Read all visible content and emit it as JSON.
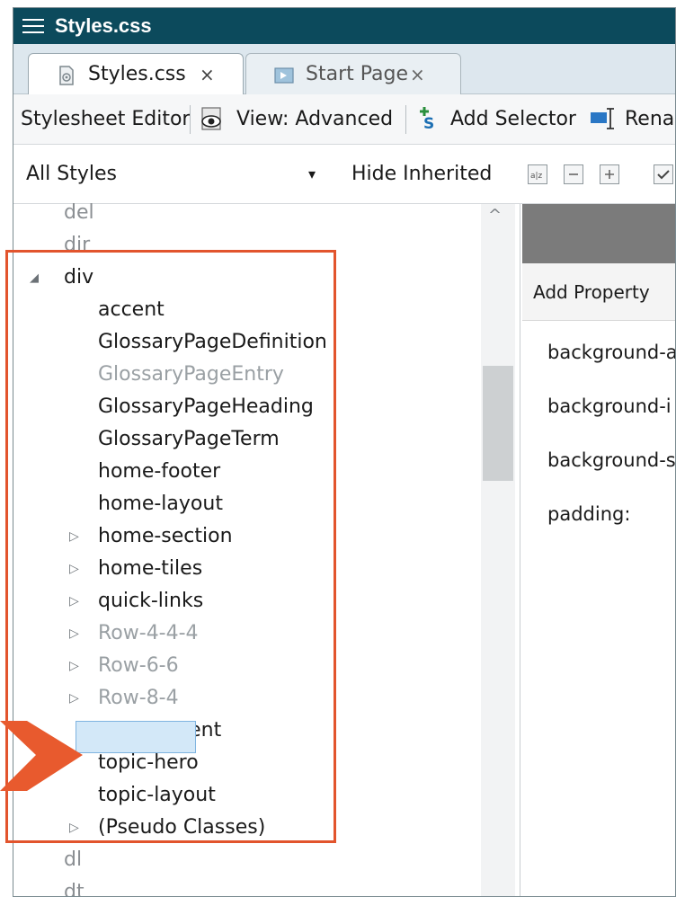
{
  "window": {
    "title": "Styles.css"
  },
  "tabs": [
    {
      "label": "Styles.css",
      "close": "×",
      "active": true
    },
    {
      "label": "Start Page",
      "close": "×",
      "active": false
    }
  ],
  "toolbar": {
    "editor_label": "Stylesheet Editor",
    "view_label": "View: Advanced",
    "add_selector_label": "Add Selector",
    "rename_label": "Rena"
  },
  "filterbar": {
    "dropdown_value": "All Styles",
    "dropdown_arrow": "▾",
    "hide_inherited_label": "Hide Inherited"
  },
  "tree": {
    "top_items": [
      "del",
      "dir"
    ],
    "parent": {
      "label": "div",
      "expander": "◢"
    },
    "children": [
      {
        "label": "accent",
        "expandable": false,
        "dim": false
      },
      {
        "label": "GlossaryPageDefinition",
        "expandable": false,
        "dim": false
      },
      {
        "label": "GlossaryPageEntry",
        "expandable": false,
        "dim": true
      },
      {
        "label": "GlossaryPageHeading",
        "expandable": false,
        "dim": false
      },
      {
        "label": "GlossaryPageTerm",
        "expandable": false,
        "dim": false
      },
      {
        "label": "home-footer",
        "expandable": false,
        "dim": false
      },
      {
        "label": "home-layout",
        "expandable": false,
        "dim": false
      },
      {
        "label": "home-section",
        "expandable": true,
        "dim": false
      },
      {
        "label": "home-tiles",
        "expandable": true,
        "dim": false
      },
      {
        "label": "quick-links",
        "expandable": true,
        "dim": false
      },
      {
        "label": "Row-4-4-4",
        "expandable": true,
        "dim": true
      },
      {
        "label": "Row-6-6",
        "expandable": true,
        "dim": true
      },
      {
        "label": "Row-8-4",
        "expandable": true,
        "dim": true
      },
      {
        "label": "side-content",
        "expandable": false,
        "dim": false
      },
      {
        "label": "topic-hero",
        "expandable": false,
        "dim": false,
        "selected": true
      },
      {
        "label": "topic-layout",
        "expandable": false,
        "dim": false
      },
      {
        "label": "(Pseudo Classes)",
        "expandable": true,
        "dim": false
      }
    ],
    "bottom_items": [
      "dl",
      "dt"
    ],
    "collapsed_glyph": "▷",
    "scroll_up_glyph": "^"
  },
  "properties": {
    "add_property_label": "Add Property",
    "items": [
      "background-a",
      "background-i",
      "background-s",
      "padding:"
    ]
  },
  "colors": {
    "titlebar": "#0c4a5c",
    "highlight": "#e2542d",
    "selection": "#d3e8f8"
  }
}
